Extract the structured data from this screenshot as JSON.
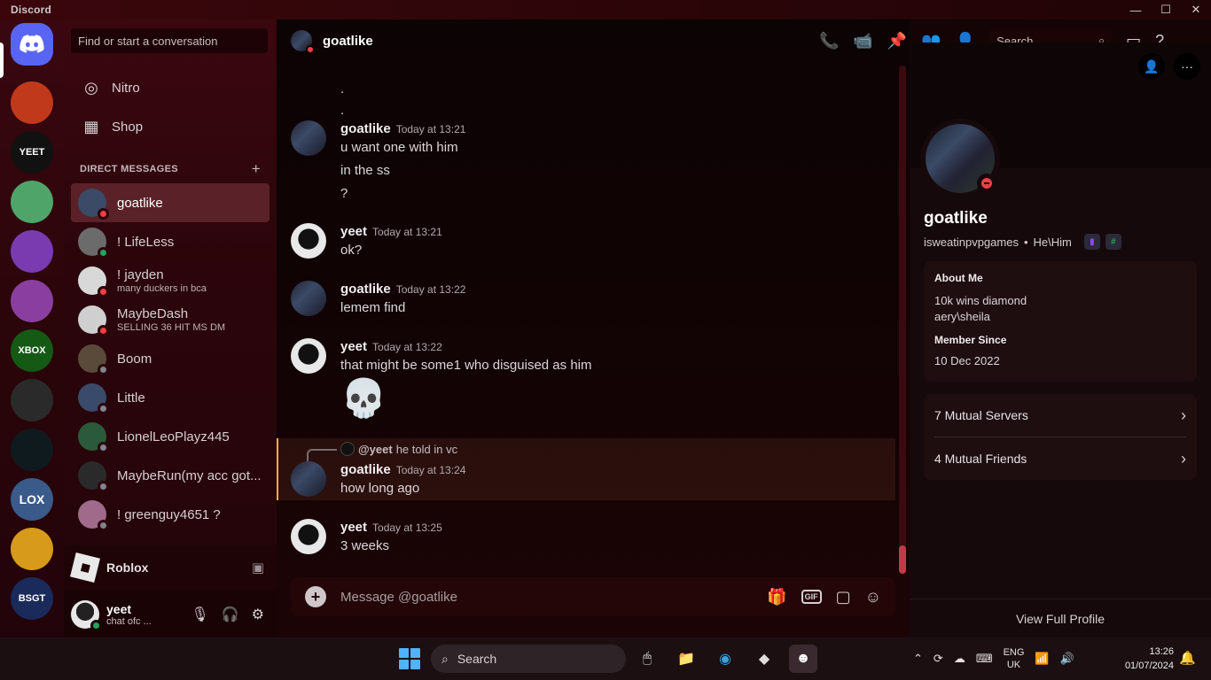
{
  "window": {
    "app_name": "Discord",
    "minimize": "—",
    "maximize": "☐",
    "close": "✕"
  },
  "search": {
    "placeholder": "Find or start a conversation"
  },
  "nav": {
    "nitro": "Nitro",
    "shop": "Shop"
  },
  "dm_header": {
    "title": "DIRECT MESSAGES",
    "add": "+"
  },
  "dms": [
    {
      "name": "goatlike",
      "sub": "",
      "status": "dnd",
      "color": "#3b4a66"
    },
    {
      "name": "! LifeLess",
      "sub": "",
      "status": "on",
      "color": "#6b6b6b"
    },
    {
      "name": "! jayden",
      "sub": "many duckers in bca",
      "status": "dnd",
      "color": "#d8d8d8"
    },
    {
      "name": "MaybeDash",
      "sub": "SELLING 36 HIT MS DM",
      "status": "dnd",
      "color": "#cfcfcf"
    },
    {
      "name": "Boom",
      "sub": "",
      "status": "off",
      "color": "#5a4a3a"
    },
    {
      "name": "Little",
      "sub": "",
      "status": "off",
      "color": "#3a4a6a"
    },
    {
      "name": "LionelLeoPlayz445",
      "sub": "",
      "status": "off",
      "color": "#2a5a3a"
    },
    {
      "name": "MaybeRun(my acc got...",
      "sub": "",
      "status": "off",
      "color": "#2a2a2a"
    },
    {
      "name": "! greenguy4651 ?",
      "sub": "",
      "status": "off",
      "color": "#a06a8a"
    }
  ],
  "activity": {
    "label": "Roblox"
  },
  "user": {
    "name": "yeet",
    "status": "chat ofc ..."
  },
  "chat": {
    "title": "goatlike",
    "search_placeholder": "Search",
    "composer_placeholder": "Message @goatlike",
    "reply_mention": "@yeet",
    "reply_text": "he told in vc",
    "skull": "💀"
  },
  "messages": [
    {
      "author": "goatlike",
      "time": "Today at 13:21",
      "lines": [
        "u want one with him",
        "in the ss",
        "?"
      ]
    },
    {
      "author": "yeet",
      "time": "Today at 13:21",
      "lines": [
        "ok?"
      ]
    },
    {
      "author": "goatlike",
      "time": "Today at 13:22",
      "lines": [
        "lemem find"
      ]
    },
    {
      "author": "yeet",
      "time": "Today at 13:22",
      "lines": [
        "that might be some1 who disguised as him"
      ]
    },
    {
      "author": "goatlike",
      "time": "Today at 13:24",
      "lines": [
        "how long ago"
      ]
    },
    {
      "author": "yeet",
      "time": "Today at 13:25",
      "lines": [
        "3 weeks"
      ]
    }
  ],
  "dots": [
    ".",
    "."
  ],
  "profile": {
    "name": "goatlike",
    "username": "isweatinpvpgames",
    "pronouns": "He\\Him",
    "separator": "•",
    "about_title": "About Me",
    "about_lines": [
      "10k wins diamond",
      "aery\\sheila"
    ],
    "member_title": "Member Since",
    "member_date": "10 Dec 2022",
    "mutual_servers": "7 Mutual Servers",
    "mutual_friends": "4 Mutual Friends",
    "view_full": "View Full Profile",
    "more": "···"
  },
  "taskbar": {
    "search": "Search",
    "lang1": "ENG",
    "lang2": "UK",
    "time": "13:26",
    "date": "01/07/2024"
  },
  "servers": [
    {
      "label": "",
      "color": "#c0391b"
    },
    {
      "label": "YEET",
      "color": "#111111"
    },
    {
      "label": "",
      "color": "#4fa46a"
    },
    {
      "label": "",
      "color": "#7a3ab0"
    },
    {
      "label": "",
      "color": "#8a3fa0"
    },
    {
      "label": "XBOX",
      "color": "#145a14"
    },
    {
      "label": "",
      "color": "#2a2a2a"
    },
    {
      "label": "",
      "color": "#0f1a1f"
    },
    {
      "label": "LOX",
      "color": "#3a5a8a"
    },
    {
      "label": "",
      "color": "#d89a1a"
    },
    {
      "label": "BSGT",
      "color": "#1a2a5a"
    }
  ],
  "colors": {
    "accent": "#5865f2",
    "dnd": "#f23f43",
    "online": "#23a55a",
    "offline": "#80848e",
    "highlight": "#f0b232"
  }
}
